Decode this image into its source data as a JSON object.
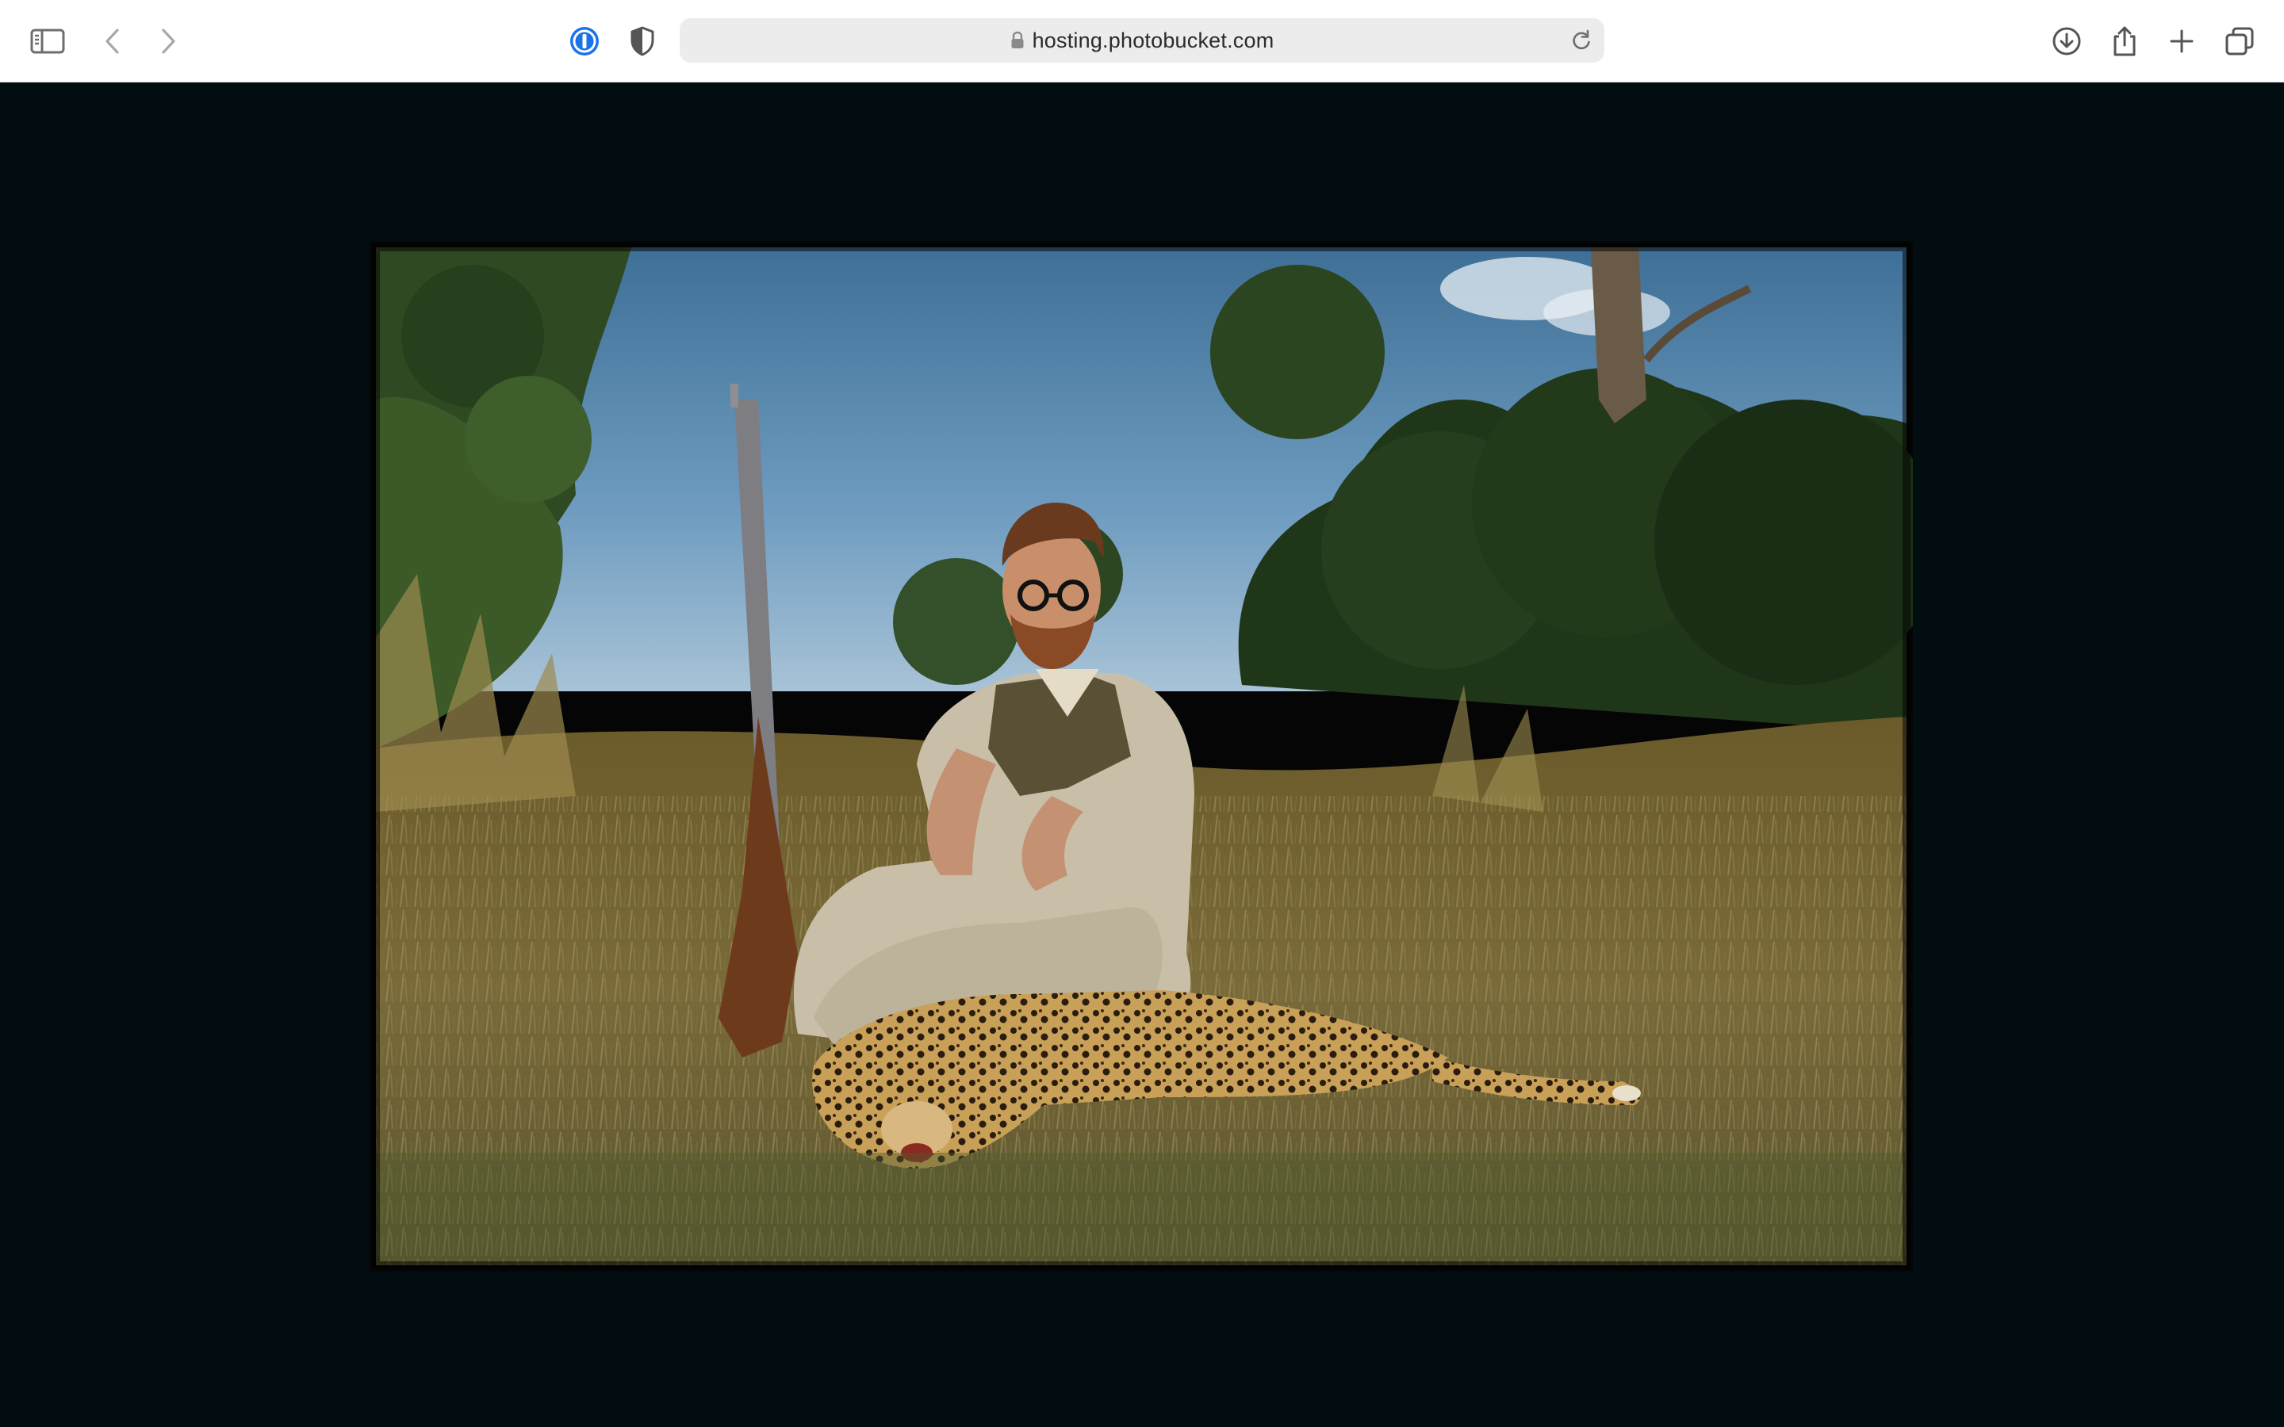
{
  "browser": {
    "url": "hosting.photobucket.com",
    "icons": {
      "sidebar": "sidebar-icon",
      "back": "chevron-left-icon",
      "forward": "chevron-right-icon",
      "password_manager": "1password-icon",
      "privacy": "shield-icon",
      "lock": "lock-icon",
      "reload": "reload-icon",
      "download": "download-icon",
      "share": "share-icon",
      "new_tab": "plus-icon",
      "tabs": "tabs-overview-icon"
    },
    "accent_color": "#1a73e8"
  },
  "page": {
    "background_color": "#010d10",
    "image_subject": "photo"
  }
}
